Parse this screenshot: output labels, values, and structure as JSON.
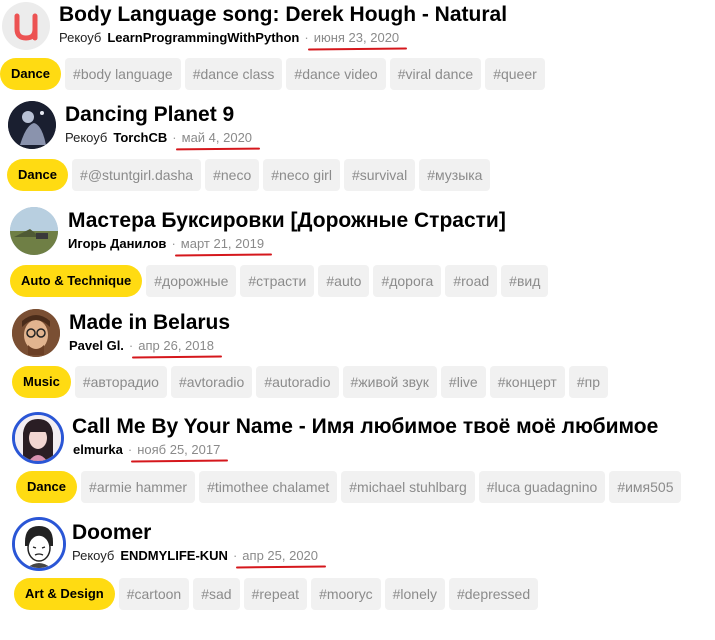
{
  "items": [
    {
      "title": "Body Language song: Derek Hough - Natural",
      "channel": "Рекоуб",
      "author": "LearnProgrammingWithPython",
      "date": "июня 23, 2020",
      "category": "Dance",
      "tags": [
        "#body language",
        "#dance class",
        "#dance video",
        "#viral dance",
        "#queer"
      ],
      "avatar_icon": "udemy-logo-icon"
    },
    {
      "title": "Dancing Planet 9",
      "channel": "Рекоуб",
      "author": "TorchCB",
      "date": "май 4, 2020",
      "category": "Dance",
      "tags": [
        "#@stuntgirl.dasha",
        "#neco",
        "#neco girl",
        "#survival",
        "#музыка"
      ],
      "avatar_icon": "dark-figure-avatar"
    },
    {
      "title": "Мастера Буксировки [Дорожные Страсти]",
      "channel": "",
      "author": "Игорь Данилов",
      "date": "март 21, 2019",
      "category": "Auto & Technique",
      "tags": [
        "#дорожные",
        "#страсти",
        "#auto",
        "#дорога",
        "#road",
        "#вид"
      ],
      "avatar_icon": "landscape-avatar"
    },
    {
      "title": "Made in Belarus",
      "channel": "",
      "author": "Pavel Gl.",
      "date": "апр 26, 2018",
      "category": "Music",
      "tags": [
        "#авторадио",
        "#avtoradio",
        "#autoradio",
        "#живой звук",
        "#live",
        "#концерт",
        "#пр"
      ],
      "avatar_icon": "man-glasses-avatar"
    },
    {
      "title": "Call Me By Your Name - Имя любимое твоё моё любимое",
      "channel": "",
      "author": "elmurka",
      "date": "нояб 25, 2017",
      "category": "Dance",
      "tags": [
        "#armie hammer",
        "#timothee chalamet",
        "#michael stuhlbarg",
        "#luca guadagnino",
        "#имя505"
      ],
      "avatar_icon": "girl-portrait-avatar"
    },
    {
      "title": "Doomer",
      "channel": "Рекоуб",
      "author": "ENDMYLIFE-KUN",
      "date": "апр 25, 2020",
      "category": "Art & Design",
      "tags": [
        "#cartoon",
        "#sad",
        "#repeat",
        "#moorус",
        "#lonely",
        "#depressed"
      ],
      "avatar_icon": "doomer-wojak-avatar"
    }
  ]
}
